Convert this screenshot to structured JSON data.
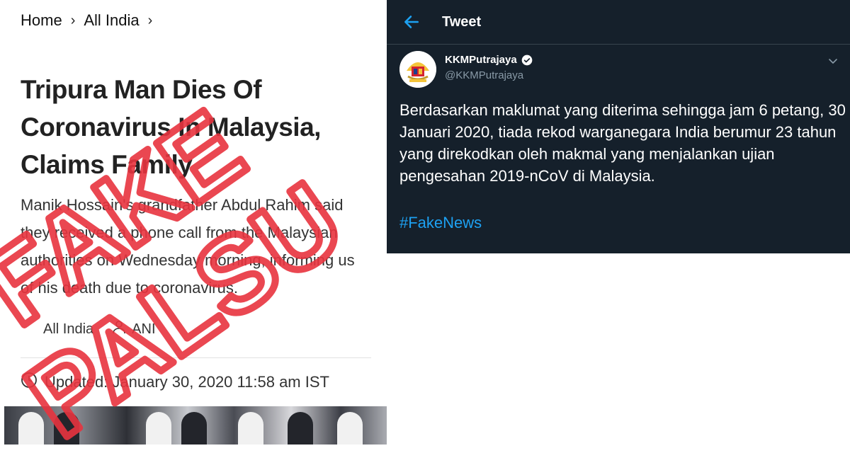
{
  "article": {
    "breadcrumb": {
      "home": "Home",
      "section": "All India"
    },
    "headline": "Tripura Man Dies Of Coronavirus In Malaysia, Claims Family",
    "excerpt": "Manik Hossain's grandfather Abdul Rahim said they received a phone call from the Malaysian authorities on Wednesday morning, informing us of his death due to coronavirus.",
    "category": "All India",
    "author": "ANI",
    "updated": "Updated: January 30, 2020 11:58 am IST"
  },
  "stamp": {
    "word_top": "FAKE",
    "word_bottom": "PALSU",
    "color": "#e8343f"
  },
  "tweet": {
    "header_title": "Tweet",
    "name": "KKMPutrajaya",
    "handle": "@KKMPutrajaya",
    "body": "Berdasarkan maklumat yang diterima sehingga jam 6 petang, 30 Januari 2020,  tiada rekod warganegara India berumur 23 tahun yang direkodkan oleh makmal yang menjalankan ujian pengesahan 2019-nCoV di Malaysia.",
    "hashtag": "#FakeNews",
    "colors": {
      "background": "#15202b",
      "accent": "#1da1f2",
      "muted": "#8899a6"
    }
  },
  "icons": [
    "chevron-right-icon",
    "user-icon",
    "clock-icon",
    "back-arrow-icon",
    "verified-badge-icon",
    "chevron-down-icon"
  ]
}
